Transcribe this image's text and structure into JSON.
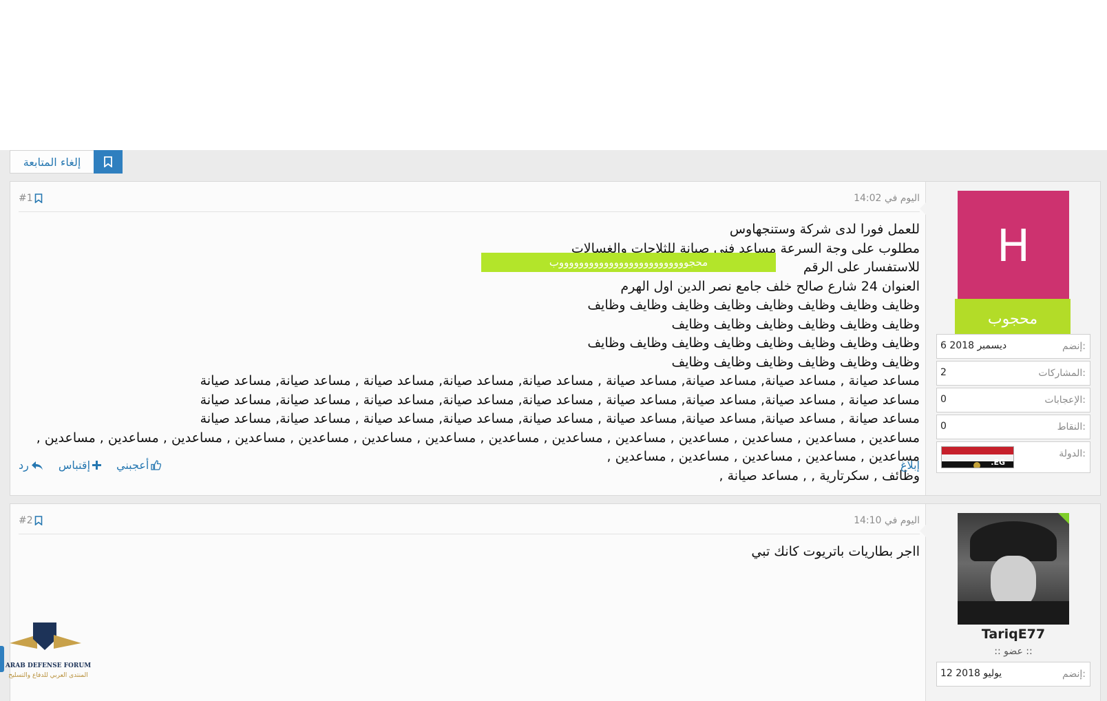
{
  "thread": {
    "unfollow_label": "إلغاء المتابعة"
  },
  "posts": [
    {
      "date": "اليوم في 14:02",
      "number": "#1",
      "author": {
        "avatar_letter": "H",
        "badge": "محجوب",
        "info": [
          {
            "key": "إنضم:",
            "value": "6 ديسمبر 2018"
          },
          {
            "key": "المشاركات:",
            "value": "2"
          },
          {
            "key": "الإعجابات:",
            "value": "0"
          },
          {
            "key": "النقاط:",
            "value": "0"
          },
          {
            "key": "الدولة:",
            "value": ""
          }
        ],
        "flag_text": ".EG"
      },
      "lines": [
        "للعمل فورا لدى شركة وستنجهاوس",
        "مطلوب على وجة السرعة مساعد فنى صيانة للثلاجات والغسالات",
        "للاستفسار على الرقم",
        "العنوان 24 شارع صالح خلف جامع نصر الدين اول الهرم",
        "وظايف وظايف وظايف وظايف وظايف وظايف وظايف وظايف وظايف وظايف وظايف وظايف وظايف وظايف",
        "وظايف وظايف وظايف وظايف وظايف وظايف وظايف وظايف وظايف وظايف وظايف وظايف وظايف وظايف",
        "مساعد صيانة , مساعد صيانة, مساعد صيانة, مساعد صيانة , مساعد صيانة, مساعد صيانة, مساعد صيانة , مساعد صيانة, مساعد صيانة",
        "مساعد صيانة , مساعد صيانة, مساعد صيانة, مساعد صيانة , مساعد صيانة, مساعد صيانة, مساعد صيانة , مساعد صيانة, مساعد صيانة",
        "مساعد صيانة , مساعد صيانة, مساعد صيانة, مساعد صيانة , مساعد صيانة, مساعد صيانة, مساعد صيانة , مساعد صيانة, مساعد صيانة",
        "مساعدين , مساعدين , مساعدين , مساعدين , مساعدين , مساعدين , مساعدين , مساعدين , مساعدين , مساعدين , مساعدين , مساعدين , مساعدين , مساعدين , مساعدين , مساعدين , مساعدين , مساعدين , مساعدين ,",
        "وظائف , سكرتارية , , مساعد صيانة ,"
      ],
      "redacted_text": "محجووووووووووووووووووووووووووب",
      "report_label": "إبلاغ",
      "like_label": "أعجبني",
      "quote_label": "إقتباس",
      "reply_label": "رد"
    },
    {
      "date": "اليوم في 14:10",
      "number": "#2",
      "author": {
        "username": "TariqE77",
        "usertitle": ":: عضو ::",
        "info": [
          {
            "key": "إنضم:",
            "value": "12 يوليو 2018"
          }
        ]
      },
      "lines": [
        "ااجر بطاريات باتريوت كانك تبي"
      ]
    }
  ],
  "watermark": {
    "line1": "ARAB DEFENSE FORUM",
    "line2": "المنتدى العربي للدفاع والتسليح"
  },
  "colors": {
    "accent": "#2f7fbf",
    "link": "#2577b1",
    "avatar_bg": "#cd326f",
    "badge_bg": "#b3dc28"
  }
}
